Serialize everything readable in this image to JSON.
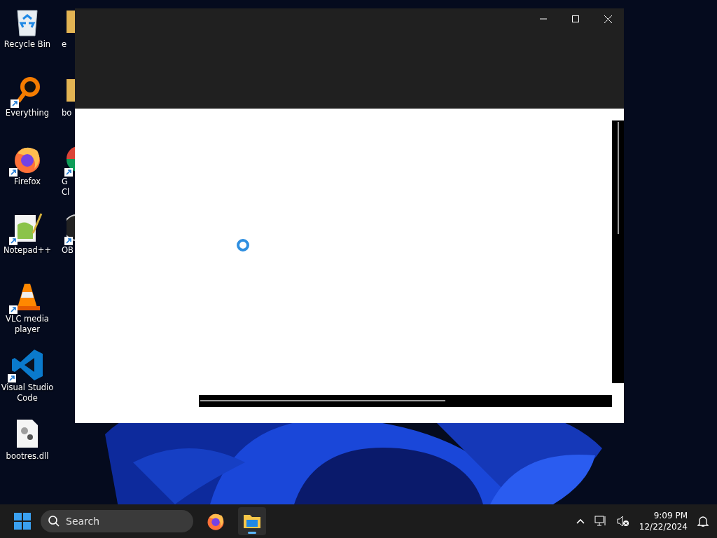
{
  "desktop_icons": [
    {
      "label": "Recycle Bin",
      "kind": "recycle",
      "shortcut": false
    },
    {
      "label": "Everything",
      "kind": "magnifier",
      "shortcut": true
    },
    {
      "label": "Firefox",
      "kind": "firefox",
      "shortcut": true
    },
    {
      "label": "Notepad++",
      "kind": "notepad",
      "shortcut": true
    },
    {
      "label": "VLC media player",
      "kind": "cone",
      "shortcut": true
    },
    {
      "label": "Visual Studio Code",
      "kind": "vscode",
      "shortcut": true
    },
    {
      "label": "bootres.dll",
      "kind": "file",
      "shortcut": false
    }
  ],
  "desktop_icons_partial": [
    {
      "label": "e",
      "kind": "archive",
      "shortcut": false
    },
    {
      "label": "bo",
      "kind": "archive",
      "shortcut": false
    },
    {
      "label": "G\nCl",
      "kind": "chrome",
      "shortcut": true
    },
    {
      "label": "OB",
      "kind": "obs",
      "shortcut": true
    }
  ],
  "window": {
    "controls": [
      {
        "kind": "minimize"
      },
      {
        "kind": "maximize"
      },
      {
        "kind": "close"
      }
    ],
    "loading": true
  },
  "taskbar": {
    "search": {
      "placeholder": "Search"
    },
    "pinned": [
      {
        "kind": "firefox",
        "running": false
      },
      {
        "kind": "explorer",
        "running": true
      }
    ],
    "time": "9:09 PM",
    "date": "12/22/2024"
  }
}
